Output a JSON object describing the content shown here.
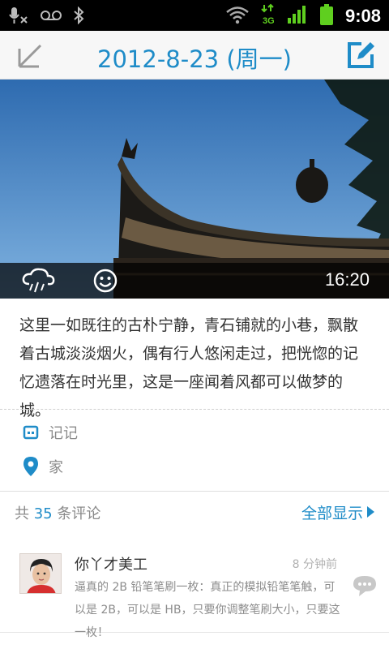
{
  "status_bar": {
    "time": "9:08",
    "network_label": "3G"
  },
  "header": {
    "title": "2012-8-23 (周一)"
  },
  "photo": {
    "time": "16:20"
  },
  "diary": {
    "text": "这里一如既往的古朴宁静，青石铺就的小巷，飘散着古城淡淡烟火，偶有行人悠闲走过，把恍惚的记忆遗落在时光里，这是一座闻着风都可以做梦的城。"
  },
  "meta": {
    "tag": "记记",
    "location": "家"
  },
  "comments": {
    "count_prefix": "共",
    "count": "35",
    "count_suffix": "条评论",
    "show_all": "全部显示",
    "items": [
      {
        "name": "你丫才美工",
        "ago": "8 分钟前",
        "text": "逼真的 2B 铅笔笔刷一枚：真正的模拟铅笔笔触，可以是 2B，可以是 HB，只要你调整笔刷大小，只要这一枚！"
      }
    ]
  },
  "colors": {
    "accent": "#1f8cc8",
    "status_green": "#5fcf1f"
  }
}
